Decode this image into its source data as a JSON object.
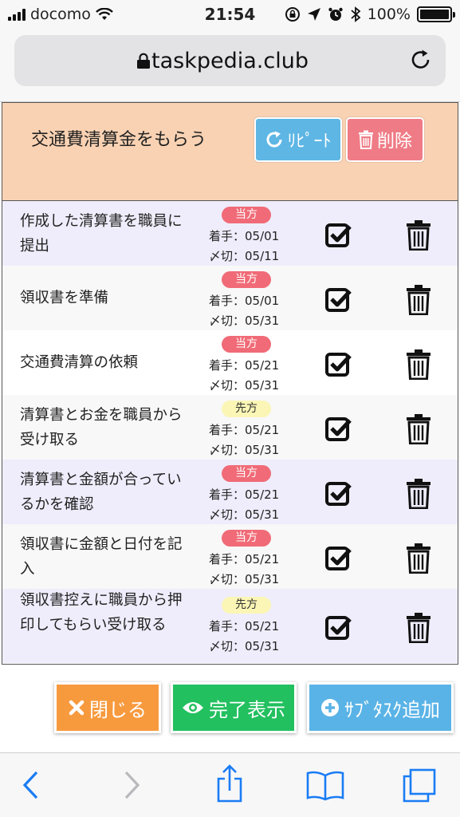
{
  "status_bar": {
    "carrier": "docomo",
    "time": "21:54",
    "battery": "100%"
  },
  "browser": {
    "url": "taskpedia.club"
  },
  "task": {
    "title": "交通費清算金をもらう",
    "repeat_label": "ﾘﾋﾟｰﾄ",
    "delete_label": "削除"
  },
  "subtasks": [
    {
      "name": "作成した清算書を職員に提出",
      "badge": "当方",
      "badge_color": "#f06b77",
      "start": "着手：05/01",
      "deadline": "〆切：05/11"
    },
    {
      "name": "領収書を準備",
      "badge": "当方",
      "badge_color": "#f06b77",
      "start": "着手：05/01",
      "deadline": "〆切：05/31"
    },
    {
      "name": "交通費清算の依頼",
      "badge": "当方",
      "badge_color": "#f06b77",
      "start": "着手：05/21",
      "deadline": "〆切：05/31"
    },
    {
      "name": "清算書とお金を職員から受け取る",
      "badge": "先方",
      "badge_color": "#fbf6b5",
      "start": "着手：05/21",
      "deadline": "〆切：05/31"
    },
    {
      "name": "清算書と金額が合っているかを確認",
      "badge": "当方",
      "badge_color": "#f06b77",
      "start": "着手：05/21",
      "deadline": "〆切：05/31"
    },
    {
      "name": "領収書に金額と日付を記入",
      "badge": "当方",
      "badge_color": "#f06b77",
      "start": "着手：05/21",
      "deadline": "〆切：05/31"
    },
    {
      "name": "領収書控えに職員から押印してもらい受け取る",
      "badge": "先方",
      "badge_color": "#fbf6b5",
      "start": "着手：05/21",
      "deadline": "〆切：05/31"
    }
  ],
  "actions": {
    "close_label": "閉じる",
    "show_done_label": "完了表示",
    "add_subtask_label": "ｻﾌﾞﾀｽｸ追加"
  },
  "icons": [
    "lock-icon",
    "reload-icon",
    "repeat-icon",
    "trash-icon",
    "check-icon",
    "times-icon",
    "eye-icon",
    "plus-circle-icon",
    "back-icon",
    "forward-icon",
    "share-icon",
    "bookmarks-icon",
    "tabs-icon"
  ],
  "colors": {
    "header_bg": "#f9d2b3",
    "row_odd": "#efedfb",
    "repeat": "#5eb6e4",
    "delete": "#ef7b86",
    "close": "#f79a3e",
    "done": "#22c05f",
    "add": "#5ab3e6",
    "safari_blue": "#1a7cf5"
  }
}
